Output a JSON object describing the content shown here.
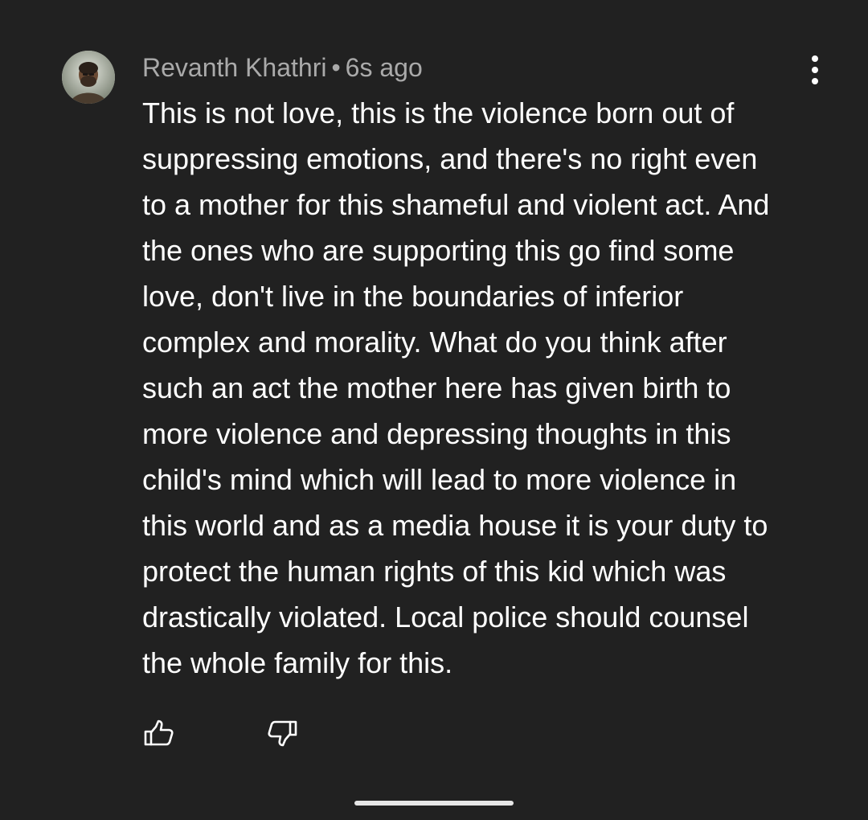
{
  "comment": {
    "author": "Revanth Khathri",
    "separator": "•",
    "timestamp": "6s ago",
    "lines": [
      "This is not love, this is the violence born out of",
      "suppressing emotions, and there's no right even",
      "to a mother for this shameful and violent act. And",
      "the ones who are supporting this go find some",
      "love, don't live in the boundaries of inferior",
      "complex and morality. What do you think after",
      "such an act the mother here has given birth to",
      "more violence and depressing thoughts in this",
      "child's mind which will lead to more violence in",
      "this world and as a media house it is your duty to",
      "protect the human rights of this kid which was",
      "drastically violated. Local police should counsel",
      "the whole family for this."
    ]
  },
  "icons": {
    "avatar": "user-avatar",
    "more": "more-vertical-icon",
    "like": "thumbs-up-icon",
    "dislike": "thumbs-down-icon"
  },
  "colors": {
    "background": "#212121",
    "meta_text": "#aaaaaa",
    "body_text": "#ffffff"
  }
}
